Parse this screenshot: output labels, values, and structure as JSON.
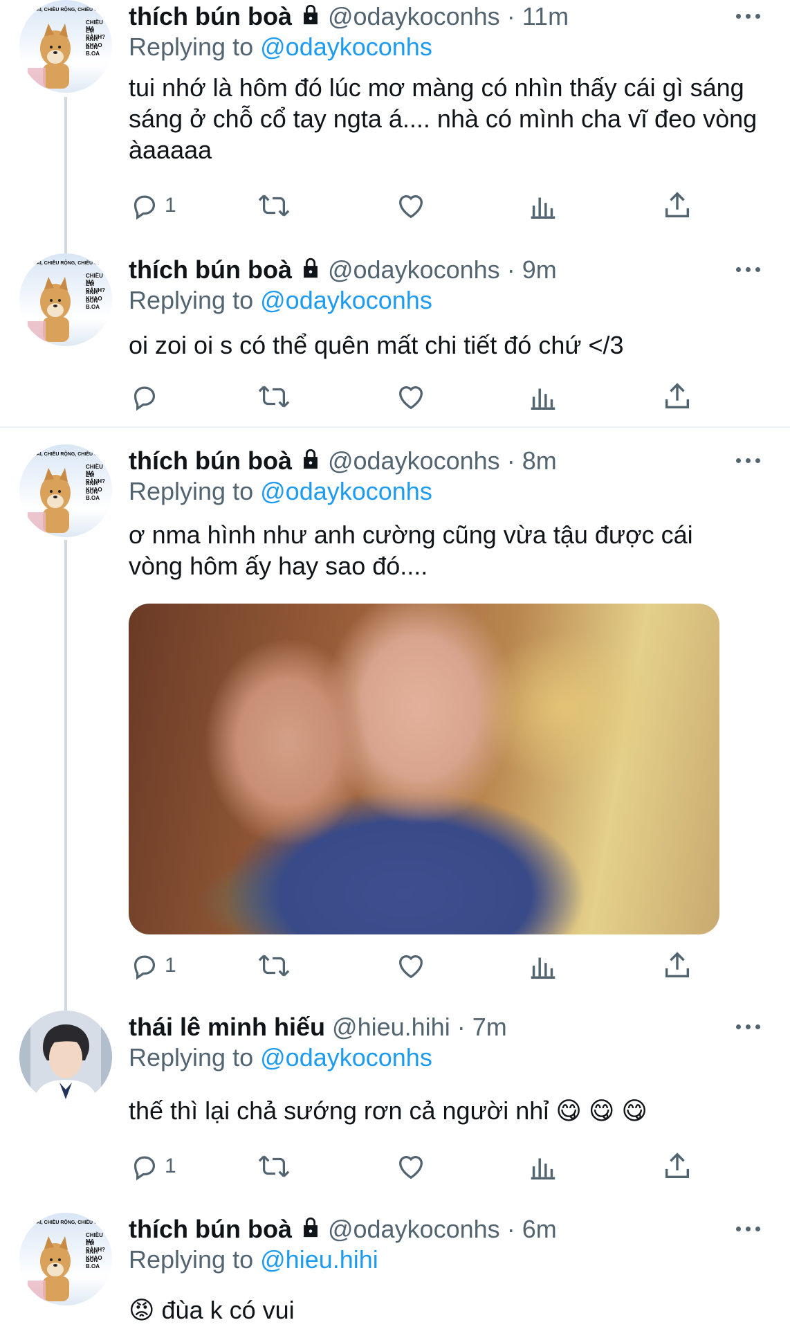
{
  "tweets": [
    {
      "name": "thích bún boà",
      "handle": "@odaykoconhs",
      "dot": "·",
      "time": "11m",
      "replying_prefix": "Replying to",
      "replying_to": "@odaykoconhs",
      "text": "tui nhớ là hôm đó lúc mơ màng có nhìn thấy cái gì sáng sáng ở chỗ cổ tay ngta á.... nhà có mình cha vĩ đeo vòng àaaaaa",
      "reply_count": "1"
    },
    {
      "name": "thích bún boà",
      "handle": "@odaykoconhs",
      "dot": "·",
      "time": "9m",
      "replying_prefix": "Replying to",
      "replying_to": "@odaykoconhs",
      "text": "oi zoi oi s có thể quên mất chi tiết đó chứ </3",
      "reply_count": ""
    },
    {
      "name": "thích bún boà",
      "handle": "@odaykoconhs",
      "dot": "·",
      "time": "8m",
      "replying_prefix": "Replying to",
      "replying_to": "@odaykoconhs",
      "text": "ơ nma hình như anh cường cũng vừa tậu được cái vòng hôm ấy hay sao đó....",
      "reply_count": "1"
    },
    {
      "name": "thái lê minh hiếu",
      "handle": "@hieu.hihi",
      "dot": "·",
      "time": "7m",
      "replying_prefix": "Replying to",
      "replying_to": "@odaykoconhs",
      "text": "thế thì lại chả sướng rơn cả người nhỉ 😋 😋 😋",
      "reply_count": "1"
    },
    {
      "name": "thích bún boà",
      "handle": "@odaykoconhs",
      "dot": "·",
      "time": "6m",
      "replying_prefix": "Replying to",
      "replying_to": "@hieu.hihi",
      "text": "😡  đùa k có vui",
      "reply_count": ""
    }
  ],
  "avatar_caption": [
    "ều dài, chiều rộng, chiều c",
    "chiều ma",
    "em rảnh?",
    "anh khao",
    "bún b.oa"
  ],
  "icons": {
    "reply": "speech-bubble-icon",
    "retweet": "retweet-icon",
    "like": "heart-icon",
    "views": "bar-chart-icon",
    "share": "share-upload-icon",
    "lock": "lock-icon",
    "more": "more-dots-icon"
  },
  "colors": {
    "accent": "#1d9bf0",
    "muted": "#536471",
    "text": "#0f1419",
    "thread": "#cfd9de"
  }
}
